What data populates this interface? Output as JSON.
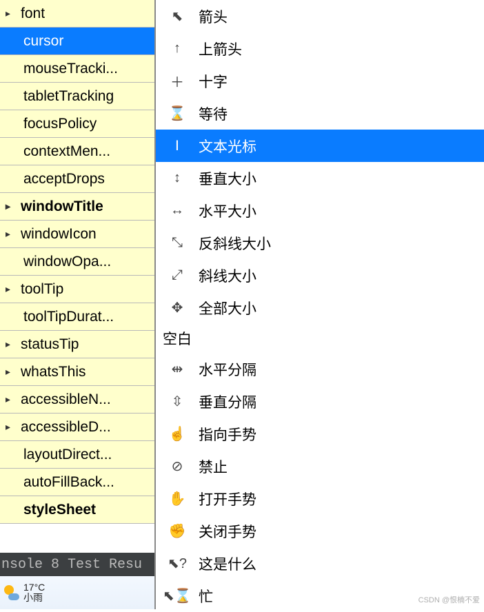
{
  "properties": [
    {
      "label": "font",
      "expandable": true,
      "bold": false,
      "selected": false,
      "indented": false
    },
    {
      "label": "cursor",
      "expandable": false,
      "bold": false,
      "selected": true,
      "indented": true
    },
    {
      "label": "mouseTracki...",
      "expandable": false,
      "bold": false,
      "selected": false,
      "indented": true
    },
    {
      "label": "tabletTracking",
      "expandable": false,
      "bold": false,
      "selected": false,
      "indented": true
    },
    {
      "label": "focusPolicy",
      "expandable": false,
      "bold": false,
      "selected": false,
      "indented": true
    },
    {
      "label": "contextMen...",
      "expandable": false,
      "bold": false,
      "selected": false,
      "indented": true
    },
    {
      "label": "acceptDrops",
      "expandable": false,
      "bold": false,
      "selected": false,
      "indented": true
    },
    {
      "label": "windowTitle",
      "expandable": true,
      "bold": true,
      "selected": false,
      "indented": false
    },
    {
      "label": "windowIcon",
      "expandable": true,
      "bold": false,
      "selected": false,
      "indented": false
    },
    {
      "label": "windowOpa...",
      "expandable": false,
      "bold": false,
      "selected": false,
      "indented": true
    },
    {
      "label": "toolTip",
      "expandable": true,
      "bold": false,
      "selected": false,
      "indented": false
    },
    {
      "label": "toolTipDurat...",
      "expandable": false,
      "bold": false,
      "selected": false,
      "indented": true
    },
    {
      "label": "statusTip",
      "expandable": true,
      "bold": false,
      "selected": false,
      "indented": false
    },
    {
      "label": "whatsThis",
      "expandable": true,
      "bold": false,
      "selected": false,
      "indented": false
    },
    {
      "label": "accessibleN...",
      "expandable": true,
      "bold": false,
      "selected": false,
      "indented": false
    },
    {
      "label": "accessibleD...",
      "expandable": true,
      "bold": false,
      "selected": false,
      "indented": false
    },
    {
      "label": "layoutDirect...",
      "expandable": false,
      "bold": false,
      "selected": false,
      "indented": true
    },
    {
      "label": "autoFillBack...",
      "expandable": false,
      "bold": false,
      "selected": false,
      "indented": true
    },
    {
      "label": "styleSheet",
      "expandable": false,
      "bold": true,
      "selected": false,
      "indented": true
    }
  ],
  "console_text": "nsole  8 Test Resu",
  "weather": {
    "temp": "17°C",
    "desc": "小雨"
  },
  "cursor_menu": [
    {
      "icon": "⬉",
      "label": "箭头",
      "selected": false
    },
    {
      "icon": "↑",
      "label": "上箭头",
      "selected": false
    },
    {
      "icon": "＋",
      "label": "十字",
      "selected": false
    },
    {
      "icon": "⌛",
      "label": "等待",
      "selected": false
    },
    {
      "icon": "Ⅰ",
      "label": "文本光标",
      "selected": true
    },
    {
      "icon": "↕",
      "label": "垂直大小",
      "selected": false
    },
    {
      "icon": "↔",
      "label": "水平大小",
      "selected": false
    },
    {
      "icon": "⤡",
      "label": "反斜线大小",
      "selected": false
    },
    {
      "icon": "⤢",
      "label": "斜线大小",
      "selected": false
    },
    {
      "icon": "✥",
      "label": "全部大小",
      "selected": false
    }
  ],
  "cursor_menu_header": "空白",
  "cursor_menu2": [
    {
      "icon": "⇹",
      "label": "水平分隔",
      "selected": false
    },
    {
      "icon": "⇳",
      "label": "垂直分隔",
      "selected": false
    },
    {
      "icon": "☝",
      "label": "指向手势",
      "selected": false
    },
    {
      "icon": "⊘",
      "label": "禁止",
      "selected": false
    },
    {
      "icon": "✋",
      "label": "打开手势",
      "selected": false
    },
    {
      "icon": "✊",
      "label": "关闭手势",
      "selected": false
    },
    {
      "icon": "⬉?",
      "label": "这是什么",
      "selected": false
    },
    {
      "icon": "⬉⌛",
      "label": "忙",
      "selected": false
    }
  ],
  "watermark": "CSDN @恨楠不爱"
}
